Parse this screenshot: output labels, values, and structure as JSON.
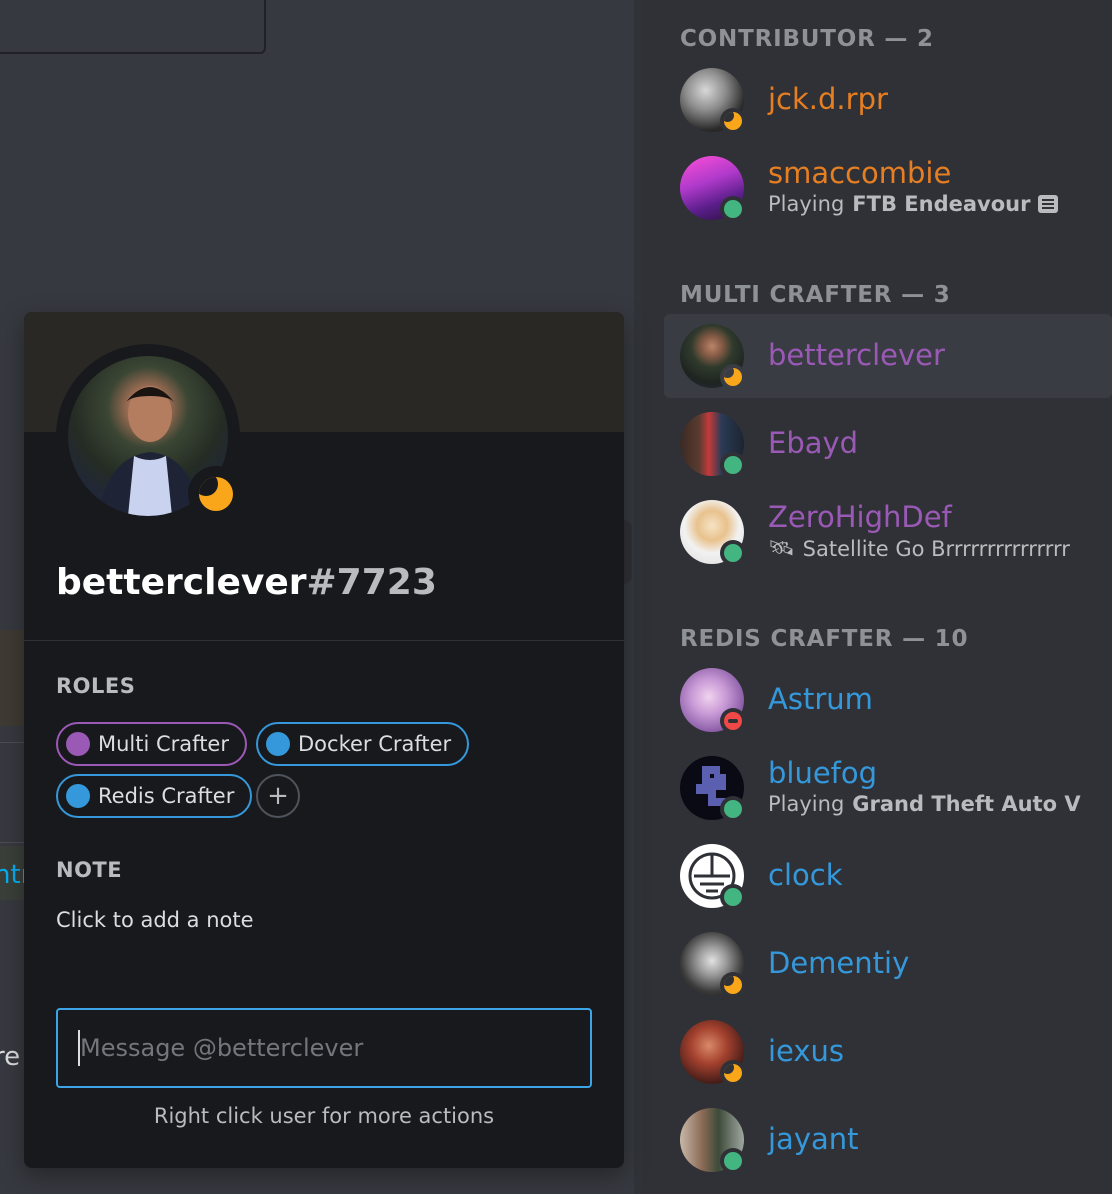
{
  "chat": {
    "fragment_link": "ntr",
    "fragment_text": "re"
  },
  "member_list": {
    "sections": [
      {
        "header": "CONTRIBUTOR — 2",
        "members": [
          {
            "name": "jck.d.rpr",
            "status": "idle",
            "role_color": "#e67e22"
          },
          {
            "name": "smaccombie",
            "status": "online",
            "role_color": "#e67e22",
            "activity_prefix": "Playing",
            "activity_name": "FTB Endeavour",
            "activity_icon": "rich-presence-icon"
          }
        ]
      },
      {
        "header": "MULTI CRAFTER — 3",
        "members": [
          {
            "name": "betterclever",
            "status": "idle",
            "role_color": "#9b59b6",
            "selected": true
          },
          {
            "name": "Ebayd",
            "status": "online",
            "role_color": "#9b59b6"
          },
          {
            "name": "ZeroHighDef",
            "status": "online",
            "role_color": "#9b59b6",
            "custom_status": "Satellite Go Brrrrrrrrrrrrrrr",
            "custom_status_emoji": "🛰"
          }
        ]
      },
      {
        "header": "REDIS CRAFTER — 10",
        "members": [
          {
            "name": "Astrum",
            "status": "dnd",
            "role_color": "#3498db"
          },
          {
            "name": "bluefog",
            "status": "online",
            "role_color": "#3498db",
            "activity_prefix": "Playing",
            "activity_name": "Grand Theft Auto V"
          },
          {
            "name": "clock",
            "status": "online",
            "role_color": "#3498db"
          },
          {
            "name": "Dementiy",
            "status": "idle",
            "role_color": "#3498db"
          },
          {
            "name": "iexus",
            "status": "idle",
            "role_color": "#3498db"
          },
          {
            "name": "jayant",
            "status": "online",
            "role_color": "#3498db"
          }
        ]
      }
    ]
  },
  "profile": {
    "username": "betterclever",
    "discriminator": "#7723",
    "status": "idle",
    "roles_label": "ROLES",
    "roles": [
      {
        "name": "Multi Crafter",
        "color": "#9b59b6"
      },
      {
        "name": "Docker Crafter",
        "color": "#3498db"
      },
      {
        "name": "Redis Crafter",
        "color": "#3498db"
      }
    ],
    "add_role_label": "+",
    "note_label": "NOTE",
    "note_placeholder": "Click to add a note",
    "message_placeholder": "Message @betterclever",
    "hint": "Right click user for more actions"
  },
  "colors": {
    "idle": "#faa61a",
    "online": "#43b581",
    "dnd": "#f04747",
    "input_focus": "#3ba5e6"
  }
}
